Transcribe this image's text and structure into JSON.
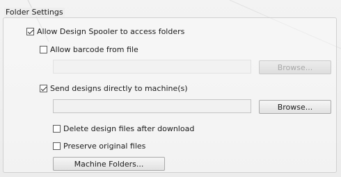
{
  "group": {
    "title": "Folder Settings"
  },
  "options": {
    "allow_spooler": {
      "label": "Allow Design Spooler to access folders",
      "checked": true
    },
    "allow_barcode": {
      "label": "Allow barcode from file",
      "checked": false
    },
    "send_direct": {
      "label": "Send designs directly to machine(s)",
      "checked": true
    },
    "delete_after": {
      "label": "Delete design files after download",
      "checked": false
    },
    "preserve": {
      "label": "Preserve original files",
      "checked": false
    }
  },
  "barcode_path": {
    "value": "",
    "enabled": false
  },
  "machine_path": {
    "value": "",
    "enabled": true
  },
  "buttons": {
    "browse_barcode": {
      "label": "Browse...",
      "enabled": false
    },
    "browse_machine": {
      "label": "Browse...",
      "enabled": true
    },
    "machine_folders": {
      "label": "Machine Folders..."
    }
  }
}
